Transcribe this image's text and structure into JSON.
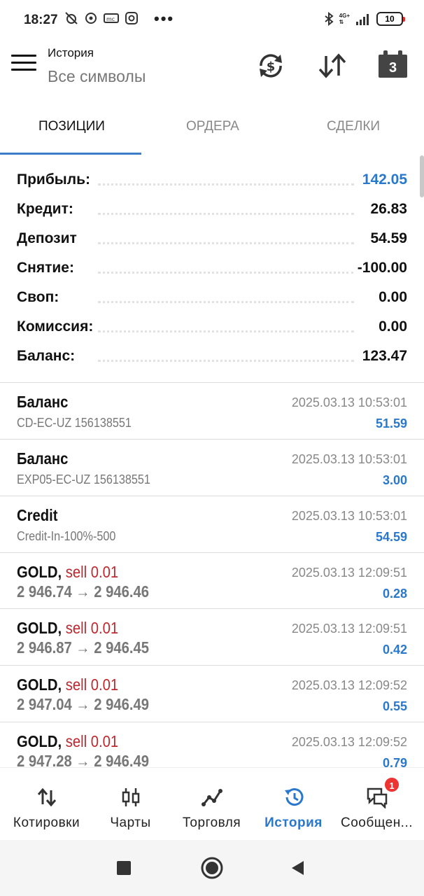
{
  "status_bar": {
    "time": "18:27",
    "battery": "10",
    "network": "4G+"
  },
  "header": {
    "title_small": "История",
    "title_big": "Все символы",
    "calendar_day": "3"
  },
  "tabs": [
    {
      "label": "ПОЗИЦИИ",
      "active": true
    },
    {
      "label": "ОРДЕРА",
      "active": false
    },
    {
      "label": "СДЕЛКИ",
      "active": false
    }
  ],
  "summary": [
    {
      "label": "Прибыль:",
      "value": "142.05",
      "highlight": true
    },
    {
      "label": "Кредит:",
      "value": "26.83",
      "highlight": false
    },
    {
      "label": "Депозит",
      "value": "54.59",
      "highlight": false
    },
    {
      "label": "Снятие:",
      "value": "-100.00",
      "highlight": false
    },
    {
      "label": "Своп:",
      "value": "0.00",
      "highlight": false
    },
    {
      "label": "Комиссия:",
      "value": "0.00",
      "highlight": false
    },
    {
      "label": "Баланс:",
      "value": "123.47",
      "highlight": false
    }
  ],
  "history": [
    {
      "title": "Баланс",
      "sell": "",
      "subtitle": "CD-EC-UZ 156138551",
      "date": "2025.03.13 10:53:01",
      "value": "51.59"
    },
    {
      "title": "Баланс",
      "sell": "",
      "subtitle": "EXP05-EC-UZ 156138551",
      "date": "2025.03.13 10:53:01",
      "value": "3.00"
    },
    {
      "title": "Credit",
      "sell": "",
      "subtitle": "Credit-In-100%-500",
      "date": "2025.03.13 10:53:01",
      "value": "54.59"
    },
    {
      "title": "GOLD,",
      "sell": "sell 0.01",
      "subtitle": "2 946.74 → 2 946.46",
      "date": "2025.03.13 12:09:51",
      "value": "0.28"
    },
    {
      "title": "GOLD,",
      "sell": "sell 0.01",
      "subtitle": "2 946.87 → 2 946.45",
      "date": "2025.03.13 12:09:51",
      "value": "0.42"
    },
    {
      "title": "GOLD,",
      "sell": "sell 0.01",
      "subtitle": "2 947.04 → 2 946.49",
      "date": "2025.03.13 12:09:52",
      "value": "0.55"
    },
    {
      "title": "GOLD,",
      "sell": "sell 0.01",
      "subtitle": "2 947.28 → 2 946.49",
      "date": "2025.03.13 12:09:52",
      "value": "0.79"
    }
  ],
  "bottom_nav": [
    {
      "label": "Котировки",
      "icon": "quotes-icon",
      "active": false
    },
    {
      "label": "Чарты",
      "icon": "chart-candles-icon",
      "active": false
    },
    {
      "label": "Торговля",
      "icon": "trade-icon",
      "active": false
    },
    {
      "label": "История",
      "icon": "history-icon",
      "active": true
    },
    {
      "label": "Сообщен...",
      "icon": "messages-icon",
      "active": false
    }
  ],
  "messages_badge": "1",
  "colors": {
    "accent": "#2a78cc",
    "sell": "#c0262d",
    "badge": "#e33333"
  }
}
